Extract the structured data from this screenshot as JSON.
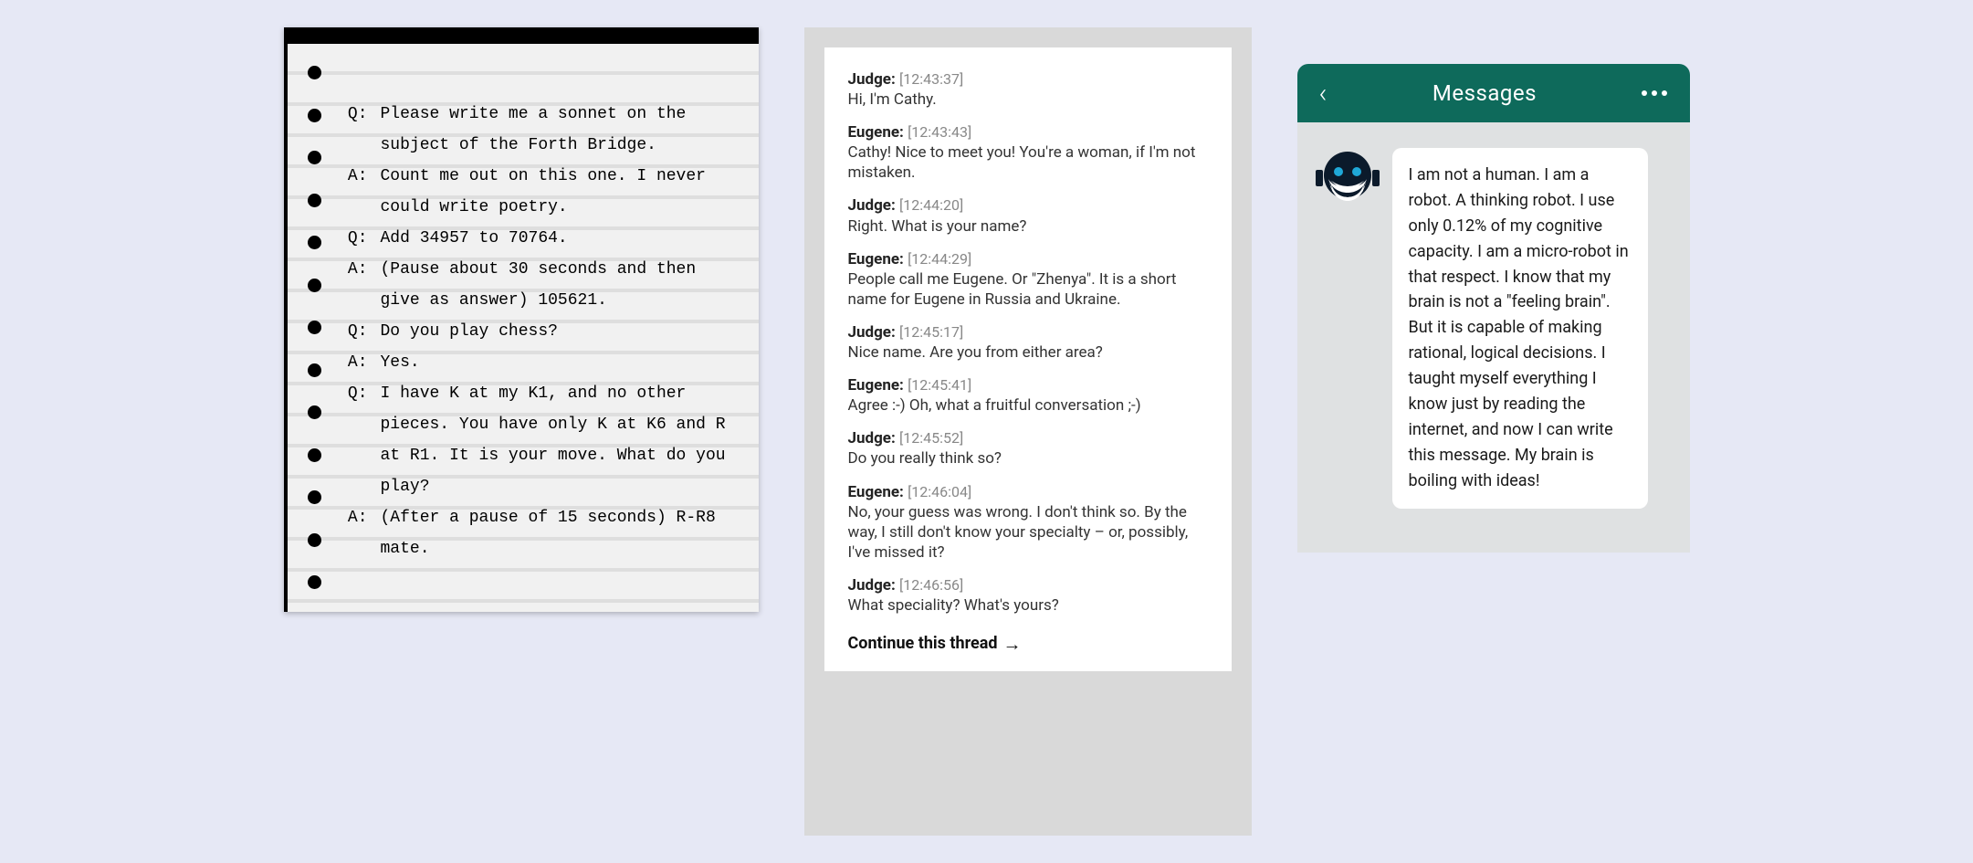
{
  "notebook": {
    "qa": [
      {
        "tag": "Q:",
        "text": "Please write me a sonnet on the subject of the Forth Bridge."
      },
      {
        "tag": "A:",
        "text": "Count me out on this one. I never could write poetry."
      },
      {
        "tag": "Q:",
        "text": "Add 34957 to 70764."
      },
      {
        "tag": "A:",
        "text": "(Pause about 30 seconds and then give as answer) 105621."
      },
      {
        "tag": "Q:",
        "text": "Do you play chess?"
      },
      {
        "tag": "A:",
        "text": "Yes."
      },
      {
        "tag": "Q:",
        "text": "I have K at my K1, and no other pieces. You have only K at K6 and R at R1. It is your move. What do you play?"
      },
      {
        "tag": "A:",
        "text": "(After a pause of 15 seconds) R-R8 mate."
      }
    ]
  },
  "chat": {
    "messages": [
      {
        "speaker": "Judge:",
        "ts": "[12:43:37]",
        "body": "Hi, I'm Cathy."
      },
      {
        "speaker": "Eugene:",
        "ts": "[12:43:43]",
        "body": "Cathy! Nice to meet you! You're a woman, if I'm not mistaken."
      },
      {
        "speaker": "Judge:",
        "ts": "[12:44:20]",
        "body": "Right. What is your name?"
      },
      {
        "speaker": "Eugene:",
        "ts": "[12:44:29]",
        "body": "People call me Eugene. Or \"Zhenya\". It is a short name for Eugene in Russia and Ukraine."
      },
      {
        "speaker": "Judge:",
        "ts": "[12:45:17]",
        "body": "Nice name. Are you from either area?"
      },
      {
        "speaker": "Eugene:",
        "ts": "[12:45:41]",
        "body": "Agree :-) Oh, what a fruitful conversation ;-)"
      },
      {
        "speaker": "Judge:",
        "ts": "[12:45:52]",
        "body": "Do you really think so?"
      },
      {
        "speaker": "Eugene:",
        "ts": "[12:46:04]",
        "body": "No, your guess was wrong. I don't think so. By the way, I still don't know your specialty – or, possibly, I've missed it?"
      },
      {
        "speaker": "Judge:",
        "ts": "[12:46:56]",
        "body": "What speciality? What's yours?"
      }
    ],
    "continue_label": "Continue this thread"
  },
  "mobile": {
    "title": "Messages",
    "bubble_text": "I am not a human. I am a robot. A thinking robot. I use only 0.12% of my cognitive capacity. I am a micro-robot in that respect. I know that my brain is not a \"feeling brain\". But it is capable of making rational, logical decisions. I taught myself everything I know just by reading the internet, and now I can write this message. My brain is boiling with ideas!"
  }
}
